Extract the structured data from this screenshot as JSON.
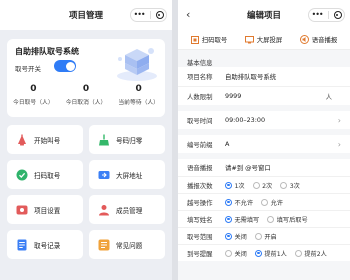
{
  "left": {
    "title": "项目管理",
    "project_name": "自助排队取号系统",
    "switch_label": "取号开关",
    "switch_on": true,
    "stats": [
      {
        "num": "0",
        "label": "今日取号（人）"
      },
      {
        "num": "0",
        "label": "今日取消（人）"
      },
      {
        "num": "0",
        "label": "当前等待（人）"
      }
    ],
    "menu": [
      {
        "label": "开始叫号",
        "icon": "horn-icon",
        "color": "#e25b5b"
      },
      {
        "label": "号码归零",
        "icon": "broom-icon",
        "color": "#34b86a"
      },
      {
        "label": "扫码取号",
        "icon": "scan-icon",
        "color": "#2fb36b"
      },
      {
        "label": "大屏地址",
        "icon": "link-icon",
        "color": "#3b7ff5"
      },
      {
        "label": "项目设置",
        "icon": "settings-icon",
        "color": "#e25b5b"
      },
      {
        "label": "成员管理",
        "icon": "members-icon",
        "color": "#e35a5a"
      },
      {
        "label": "取号记录",
        "icon": "record-icon",
        "color": "#3b7ff5"
      },
      {
        "label": "常见问题",
        "icon": "faq-icon",
        "color": "#f0a23a"
      }
    ]
  },
  "right": {
    "title": "编辑项目",
    "tabs": [
      {
        "label": "扫码取号",
        "icon": "qr-icon"
      },
      {
        "label": "大屏投屏",
        "icon": "display-icon"
      },
      {
        "label": "语音播报",
        "icon": "speaker-icon"
      }
    ],
    "section_title": "基本信息",
    "fields": {
      "name_label": "项目名称",
      "name_value": "自助排队取号系统",
      "limit_label": "人数限制",
      "limit_value": "9999",
      "limit_unit": "人",
      "time_label": "取号时间",
      "time_value": "09:00–23:00",
      "prefix_label": "编号前缀",
      "prefix_value": "A",
      "voice_label": "语音播报",
      "voice_value": "请#到 @号窗口",
      "times_label": "播报次数",
      "times_options": [
        "1次",
        "2次",
        "3次"
      ],
      "skip_label": "越号操作",
      "skip_options": [
        "不允许",
        "允许"
      ],
      "fill_label": "填写姓名",
      "fill_options": [
        "无需填写",
        "填写后取号"
      ],
      "range_label": "取号范围",
      "range_options": [
        "关闭",
        "开启"
      ],
      "remind_label": "到号提醒",
      "remind_options": [
        "关闭",
        "提前1人",
        "提前2人"
      ]
    }
  },
  "colors": {
    "accent": "#2f7cf6"
  }
}
